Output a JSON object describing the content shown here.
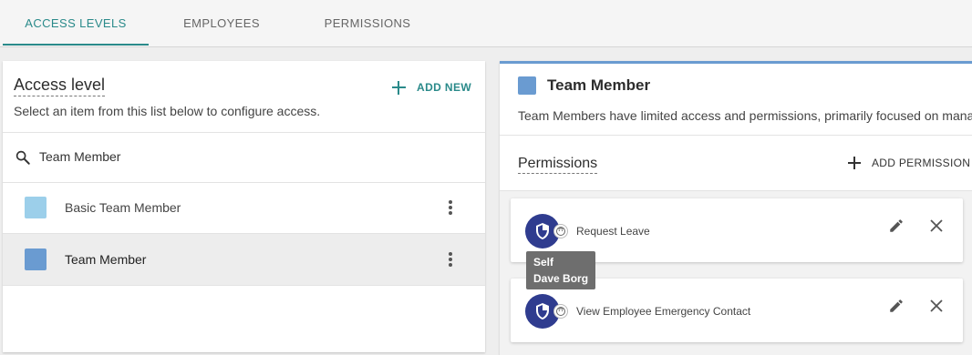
{
  "tabs": [
    {
      "label": "ACCESS LEVELS",
      "active": true
    },
    {
      "label": "EMPLOYEES",
      "active": false
    },
    {
      "label": "PERMISSIONS",
      "active": false
    }
  ],
  "left_panel": {
    "title": "Access level",
    "subtitle": "Select an item from this list below to configure access.",
    "add_new_label": "ADD NEW",
    "search": {
      "value": "Team Member",
      "icon": "search-icon"
    },
    "items": [
      {
        "label": "Basic Team Member",
        "color": "#9ccfea",
        "selected": false
      },
      {
        "label": "Team Member",
        "color": "#6a9bd1",
        "selected": true
      }
    ]
  },
  "right_panel": {
    "title": "Team Member",
    "color": "#6a9bd1",
    "description": "Team Members have limited access and permissions, primarily focused on mana",
    "permissions_title": "Permissions",
    "add_permission_label": "ADD PERMISSION",
    "permissions": [
      {
        "label": "Request Leave",
        "icon": "shield-icon",
        "badge_icon": "self-face-icon"
      },
      {
        "label": "View Employee Emergency Contact",
        "icon": "shield-icon",
        "badge_icon": "self-face-icon"
      }
    ]
  },
  "tooltip": {
    "line1": "Self",
    "line2": "Dave Borg"
  },
  "colors": {
    "accent": "#2a8a8a",
    "avatar": "#2f3c8f"
  }
}
